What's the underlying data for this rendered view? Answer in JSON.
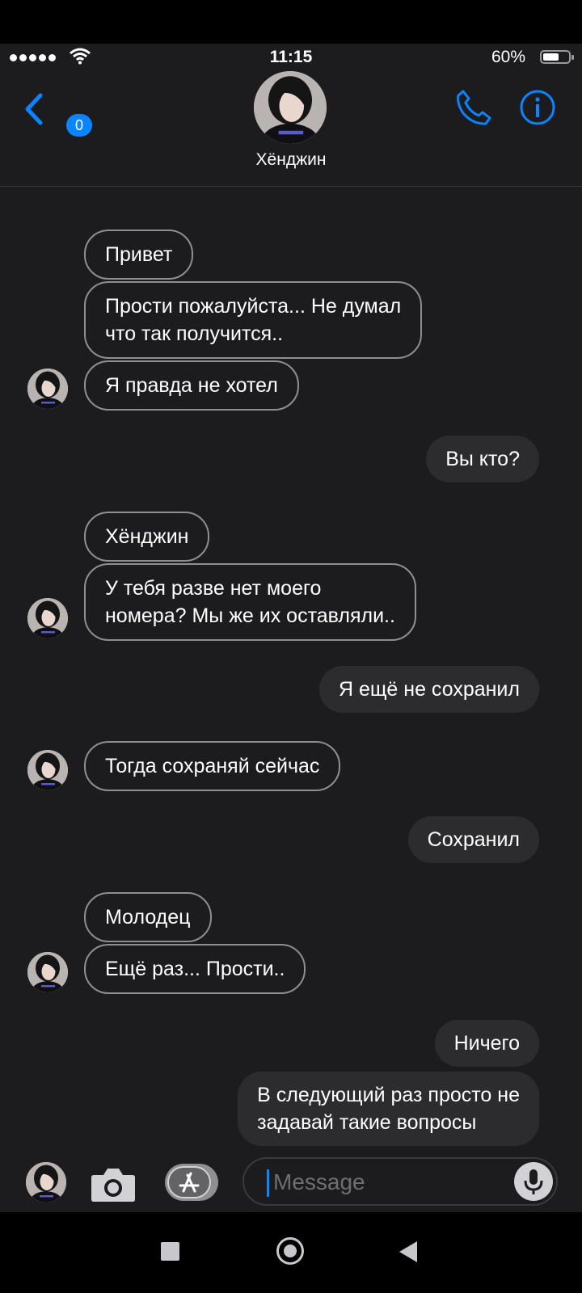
{
  "status_bar": {
    "time": "11:15",
    "battery": "60%"
  },
  "header": {
    "back_badge": "0",
    "contact_name": "Хёнджин"
  },
  "messages": [
    {
      "dir": "in",
      "text": "Привет"
    },
    {
      "dir": "in",
      "text": "Прости пожалуйста... Не думал\nчто так получится.."
    },
    {
      "dir": "in",
      "text": "Я правда не хотел"
    },
    {
      "dir": "out",
      "text": "Вы кто?"
    },
    {
      "dir": "in",
      "text": "Хёнджин"
    },
    {
      "dir": "in",
      "text": "У тебя разве нет моего\nномера? Мы же их оставляли.."
    },
    {
      "dir": "out",
      "text": "Я ещё не сохранил"
    },
    {
      "dir": "in",
      "text": "Тогда сохраняй сейчас"
    },
    {
      "dir": "out",
      "text": "Сохранил"
    },
    {
      "dir": "in",
      "text": "Молодец"
    },
    {
      "dir": "in",
      "text": "Ещё раз... Прости.."
    },
    {
      "dir": "out",
      "text": "Ничего"
    },
    {
      "dir": "out",
      "text": "В следующий раз просто не\nзадавай такие вопросы"
    }
  ],
  "composer": {
    "placeholder": "Message"
  },
  "icons": {
    "back": "chevron-left-icon",
    "call": "phone-icon",
    "info": "info-icon",
    "camera": "camera-icon",
    "apps": "app-store-icon",
    "mic": "microphone-icon"
  },
  "colors": {
    "accent": "#0a84ff",
    "background": "#1c1c1e",
    "outgoing_bubble": "#2c2c2e",
    "incoming_border": "#8e8e93"
  }
}
